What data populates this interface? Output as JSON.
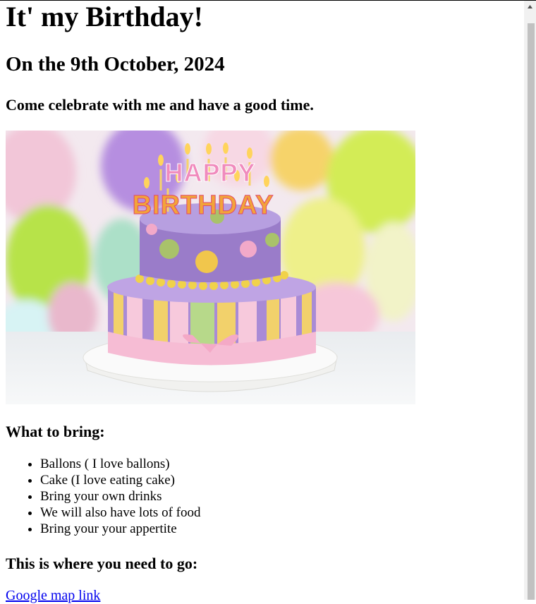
{
  "title": "It' my Birthday!",
  "date": "On the 9th October, 2024",
  "invite": "Come celebrate with me and have a good time.",
  "cake_text": {
    "line1": "HAPPY",
    "line2": "BIRTHDAY"
  },
  "bring_heading": "What to bring:",
  "bring_items": [
    "Ballons ( I love ballons)",
    "Cake (I love eating cake)",
    "Bring your own drinks",
    "We will also have lots of food",
    "Bring your your appertite"
  ],
  "where_heading": "This is where you need to go:",
  "map_link": "Google map link",
  "colors": {
    "link": "#0000ee",
    "scrollbar_thumb": "#c1c1c1"
  }
}
